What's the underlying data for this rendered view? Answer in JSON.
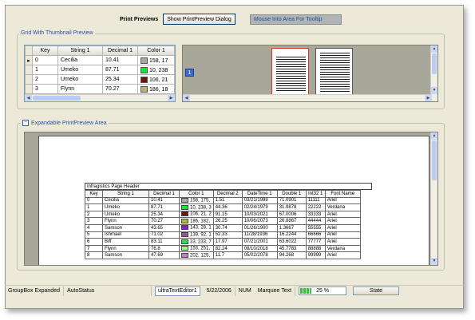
{
  "toolbar": {
    "print_previews_label": "Print Previews",
    "show_dialog_button": "Show PrintPreview Dialog",
    "tooltip_zone_text": "Mouse Into Area For Tooltip"
  },
  "grid_group": {
    "caption": "Grid With Thumbnail Preview",
    "columns": [
      "Key",
      "String 1",
      "Decimal 1",
      "Color 1"
    ],
    "rows": [
      {
        "key": "0",
        "string1": "Cecilia",
        "decimal1": "10.41",
        "color1": "158, 17",
        "swatch": "#a9a9a0"
      },
      {
        "key": "1",
        "string1": "Umeko",
        "decimal1": "87.71",
        "color1": "10, 238",
        "swatch": "#0aee30"
      },
      {
        "key": "2",
        "string1": "Umeko",
        "decimal1": "25.34",
        "color1": "106, 21",
        "swatch": "#6a1510"
      },
      {
        "key": "3",
        "string1": "Flynn",
        "decimal1": "70.27",
        "color1": "186, 18",
        "swatch": "#bab078"
      }
    ],
    "page_number": "1"
  },
  "expandable": {
    "label": "Expandable PrintPreview Area"
  },
  "preview": {
    "page_header": "Infragistics Page Header",
    "columns": [
      "Key",
      "String 1",
      "Decimal 1",
      "Color 1",
      "Decimal 2",
      "DateTime 1",
      "Double 1",
      "Int32 1",
      "Font Name"
    ],
    "rows": [
      {
        "key": "0",
        "s": "Cecilia",
        "d1": "10.41",
        "c": "158, 175,",
        "sw": "#a9b0a0",
        "d2": "1.51",
        "dt": "03/21/1998",
        "db": "71.0901",
        "i": "11111",
        "f": "Ariel"
      },
      {
        "key": "1",
        "s": "Umeko",
        "d1": "87.71",
        "c": "10, 238, 3",
        "sw": "#0aee30",
        "d2": "44.36",
        "dt": "02/24/1979",
        "db": "31.9878",
        "i": "22222",
        "f": "Verdana"
      },
      {
        "key": "2",
        "s": "Umeko",
        "d1": "25.34",
        "c": "106, 21, 2",
        "sw": "#6a1510",
        "d2": "91.15",
        "dt": "10/03/2021",
        "db": "67.0006",
        "i": "33333",
        "f": "Ariel"
      },
      {
        "key": "3",
        "s": "Flynn",
        "d1": "70.27",
        "c": "186, 182,",
        "sw": "#bab640",
        "d2": "26.25",
        "dt": "10/06/2073",
        "db": "26.8867",
        "i": "44444",
        "f": "Ariel"
      },
      {
        "key": "4",
        "s": "Samson",
        "d1": "43.65",
        "c": "143, 28, 1",
        "sw": "#8f1cc0",
        "d2": "30.74",
        "dt": "01/26/1900",
        "db": "1.3667",
        "i": "55555",
        "f": "Ariel"
      },
      {
        "key": "5",
        "s": "Ishmael",
        "d1": "71.02",
        "c": "139, 92, 1",
        "sw": "#8b5c90",
        "d2": "52.33",
        "dt": "11/28/1936",
        "db": "16.2244",
        "i": "66666",
        "f": "Ariel"
      },
      {
        "key": "6",
        "s": "Biff",
        "d1": "83.11",
        "c": "33, 233, 7",
        "sw": "#21e940",
        "d2": "17.97",
        "dt": "07/21/2001",
        "db": "63.6022",
        "i": "77777",
        "f": "Ariel"
      },
      {
        "key": "7",
        "s": "Flynn",
        "d1": "76.8",
        "c": "153, 251,",
        "sw": "#99fb90",
        "d2": "82.24",
        "dt": "08/10/2018",
        "db": "45.7783",
        "i": "88888",
        "f": "Verdana"
      },
      {
        "key": "8",
        "s": "Samson",
        "d1": "47.69",
        "c": "202, 125,",
        "sw": "#ca7dc8",
        "d2": "11.7",
        "dt": "05/02/2078",
        "db": "94.268",
        "i": "99999",
        "f": "Ariel"
      }
    ]
  },
  "status_bar": {
    "groupbox_status": "GroupBox Expanded",
    "auto_status": "AutoStatus",
    "editor_text": "ultraTextEditor1",
    "date": "5/22/2006",
    "num": "NUM",
    "marquee": "Marquee Text",
    "progress_text": "25 %",
    "progress_value": 0.25,
    "state_label": "State"
  }
}
